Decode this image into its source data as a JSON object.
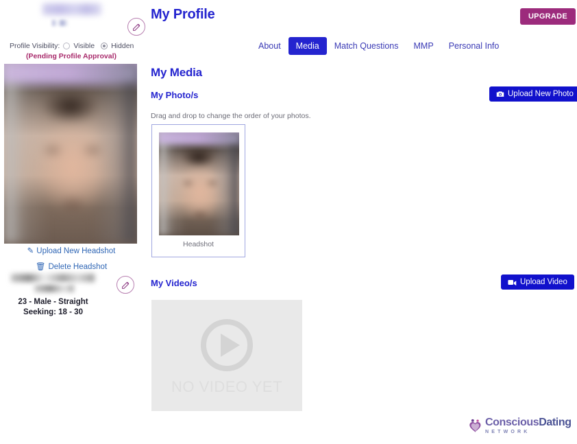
{
  "header": {
    "page_title": "My Profile",
    "upgrade_label": "UPGRADE"
  },
  "sidebar": {
    "visibility_label": "Profile Visibility:",
    "visibility_options": [
      {
        "label": "Visible",
        "selected": false
      },
      {
        "label": "Hidden",
        "selected": true
      }
    ],
    "pending_notice": "(Pending Profile Approval)",
    "upload_headshot_label": "Upload New Headshot",
    "delete_headshot_label": "Delete Headshot",
    "demographics": "23 - Male - Straight",
    "seeking": "Seeking: 18 - 30"
  },
  "tabs": [
    {
      "label": "About",
      "active": false
    },
    {
      "label": "Media",
      "active": true
    },
    {
      "label": "Match Questions",
      "active": false
    },
    {
      "label": "MMP",
      "active": false
    },
    {
      "label": "Personal Info",
      "active": false
    }
  ],
  "main": {
    "section_title": "My Media",
    "photos": {
      "sub_title": "My Photo/s",
      "hint": "Drag and drop to change the order of your photos.",
      "upload_label": "Upload New Photo",
      "items": [
        {
          "caption": "Headshot"
        }
      ]
    },
    "videos": {
      "sub_title": "My Video/s",
      "upload_label": "Upload Video",
      "empty_text": "NO VIDEO YET"
    }
  },
  "footer": {
    "logo_part1": "Conscious",
    "logo_part2": "Dating",
    "logo_sub": "NETWORK"
  },
  "colors": {
    "primary_blue": "#2424cf",
    "button_blue": "#1111cc",
    "upgrade_magenta": "#9c2b7c",
    "pending_pink": "#a82a6b",
    "link_blue": "#2f66b5"
  }
}
